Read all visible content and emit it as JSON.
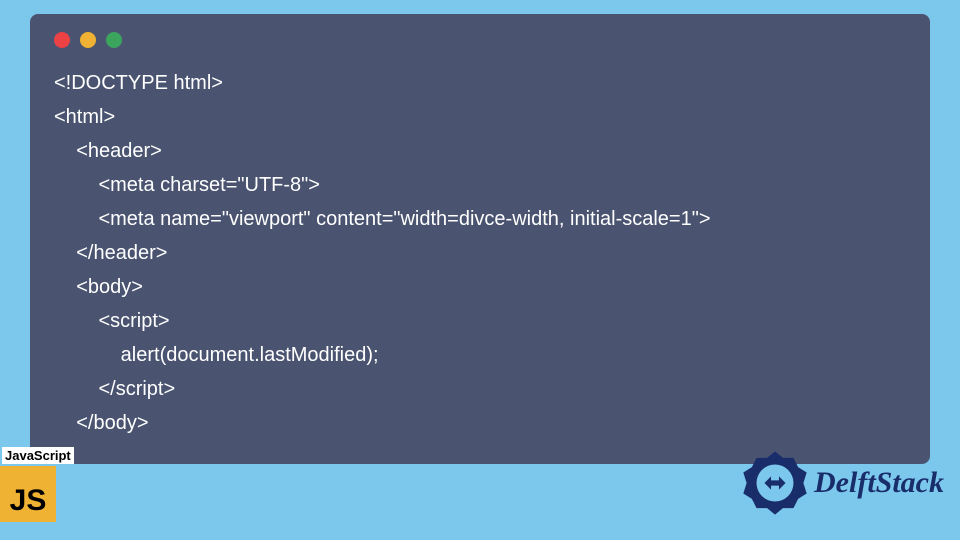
{
  "window": {
    "trafficLights": [
      "red",
      "yellow",
      "green"
    ]
  },
  "code": {
    "lines": [
      "<!DOCTYPE html>",
      "<html>",
      "    <header>",
      "        <meta charset=\"UTF-8\">",
      "        <meta name=\"viewport\" content=\"width=divce-width, initial-scale=1\">",
      "    </header>",
      "    <body>",
      "        <script>",
      "            alert(document.lastModified);",
      "        </script>",
      "    </body>"
    ]
  },
  "footer": {
    "jsLabel": "JavaScript",
    "jsBadge": "JS",
    "brand": "DelftStack"
  },
  "colors": {
    "pageBg": "#7cc8ed",
    "windowBg": "#4a5470",
    "jsBadge": "#f0b232",
    "brandColor": "#1a2d6b"
  }
}
